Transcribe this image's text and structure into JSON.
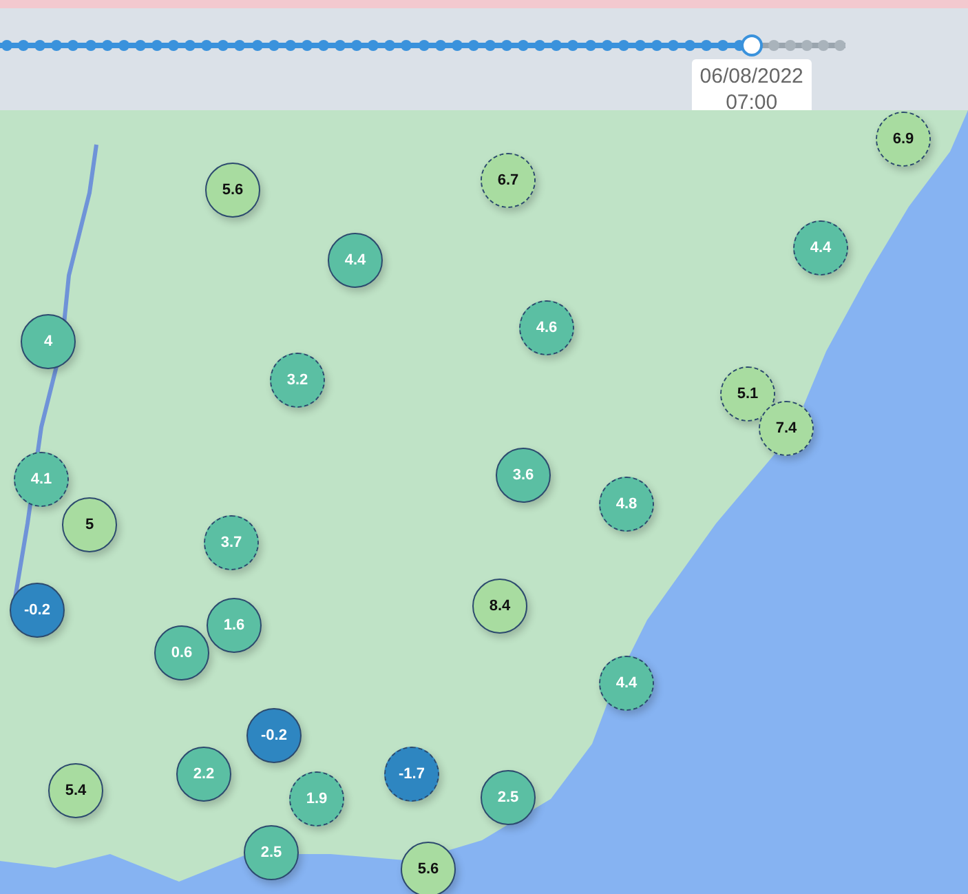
{
  "timeline": {
    "level": 0.889,
    "tooltip_date": "06/08/2022",
    "tooltip_time": "07:00"
  },
  "markers": [
    {
      "value": "6.9",
      "color": "#a8dca0",
      "dashed": true
    },
    {
      "value": "5.6",
      "color": "#a8dca0",
      "dashed": false
    },
    {
      "value": "6.7",
      "color": "#a8dca0",
      "dashed": true
    },
    {
      "value": "4.4",
      "color": "#5bbfa3",
      "dashed": false
    },
    {
      "value": "4.4",
      "color": "#5bbfa3",
      "dashed": true
    },
    {
      "value": "4",
      "color": "#5bbfa3",
      "dashed": false
    },
    {
      "value": "4.6",
      "color": "#5bbfa3",
      "dashed": true
    },
    {
      "value": "3.2",
      "color": "#5bbfa3",
      "dashed": true
    },
    {
      "value": "5.1",
      "color": "#a8dca0",
      "dashed": true
    },
    {
      "value": "7.4",
      "color": "#a8dca0",
      "dashed": true
    },
    {
      "value": "4.1",
      "color": "#5bbfa3",
      "dashed": true
    },
    {
      "value": "3.6",
      "color": "#5bbfa3",
      "dashed": false
    },
    {
      "value": "5",
      "color": "#a8dca0",
      "dashed": false
    },
    {
      "value": "4.8",
      "color": "#5bbfa3",
      "dashed": true
    },
    {
      "value": "3.7",
      "color": "#5bbfa3",
      "dashed": true
    },
    {
      "value": "-0.2",
      "color": "#2e86c1",
      "dashed": false
    },
    {
      "value": "0.6",
      "color": "#5bbfa3",
      "dashed": false
    },
    {
      "value": "1.6",
      "color": "#5bbfa3",
      "dashed": false
    },
    {
      "value": "8.4",
      "color": "#a8dca0",
      "dashed": false
    },
    {
      "value": "4.4",
      "color": "#5bbfa3",
      "dashed": true
    },
    {
      "value": "-0.2",
      "color": "#2e86c1",
      "dashed": false
    },
    {
      "value": "5.4",
      "color": "#a8dca0",
      "dashed": false
    },
    {
      "value": "2.2",
      "color": "#5bbfa3",
      "dashed": false
    },
    {
      "value": "1.9",
      "color": "#5bbfa3",
      "dashed": true
    },
    {
      "value": "-1.7",
      "color": "#2e86c1",
      "dashed": true
    },
    {
      "value": "2.5",
      "color": "#5bbfa3",
      "dashed": false
    },
    {
      "value": "2.5",
      "color": "#5bbfa3",
      "dashed": false
    },
    {
      "value": "5.6",
      "color": "#a8dca0",
      "dashed": false
    }
  ]
}
